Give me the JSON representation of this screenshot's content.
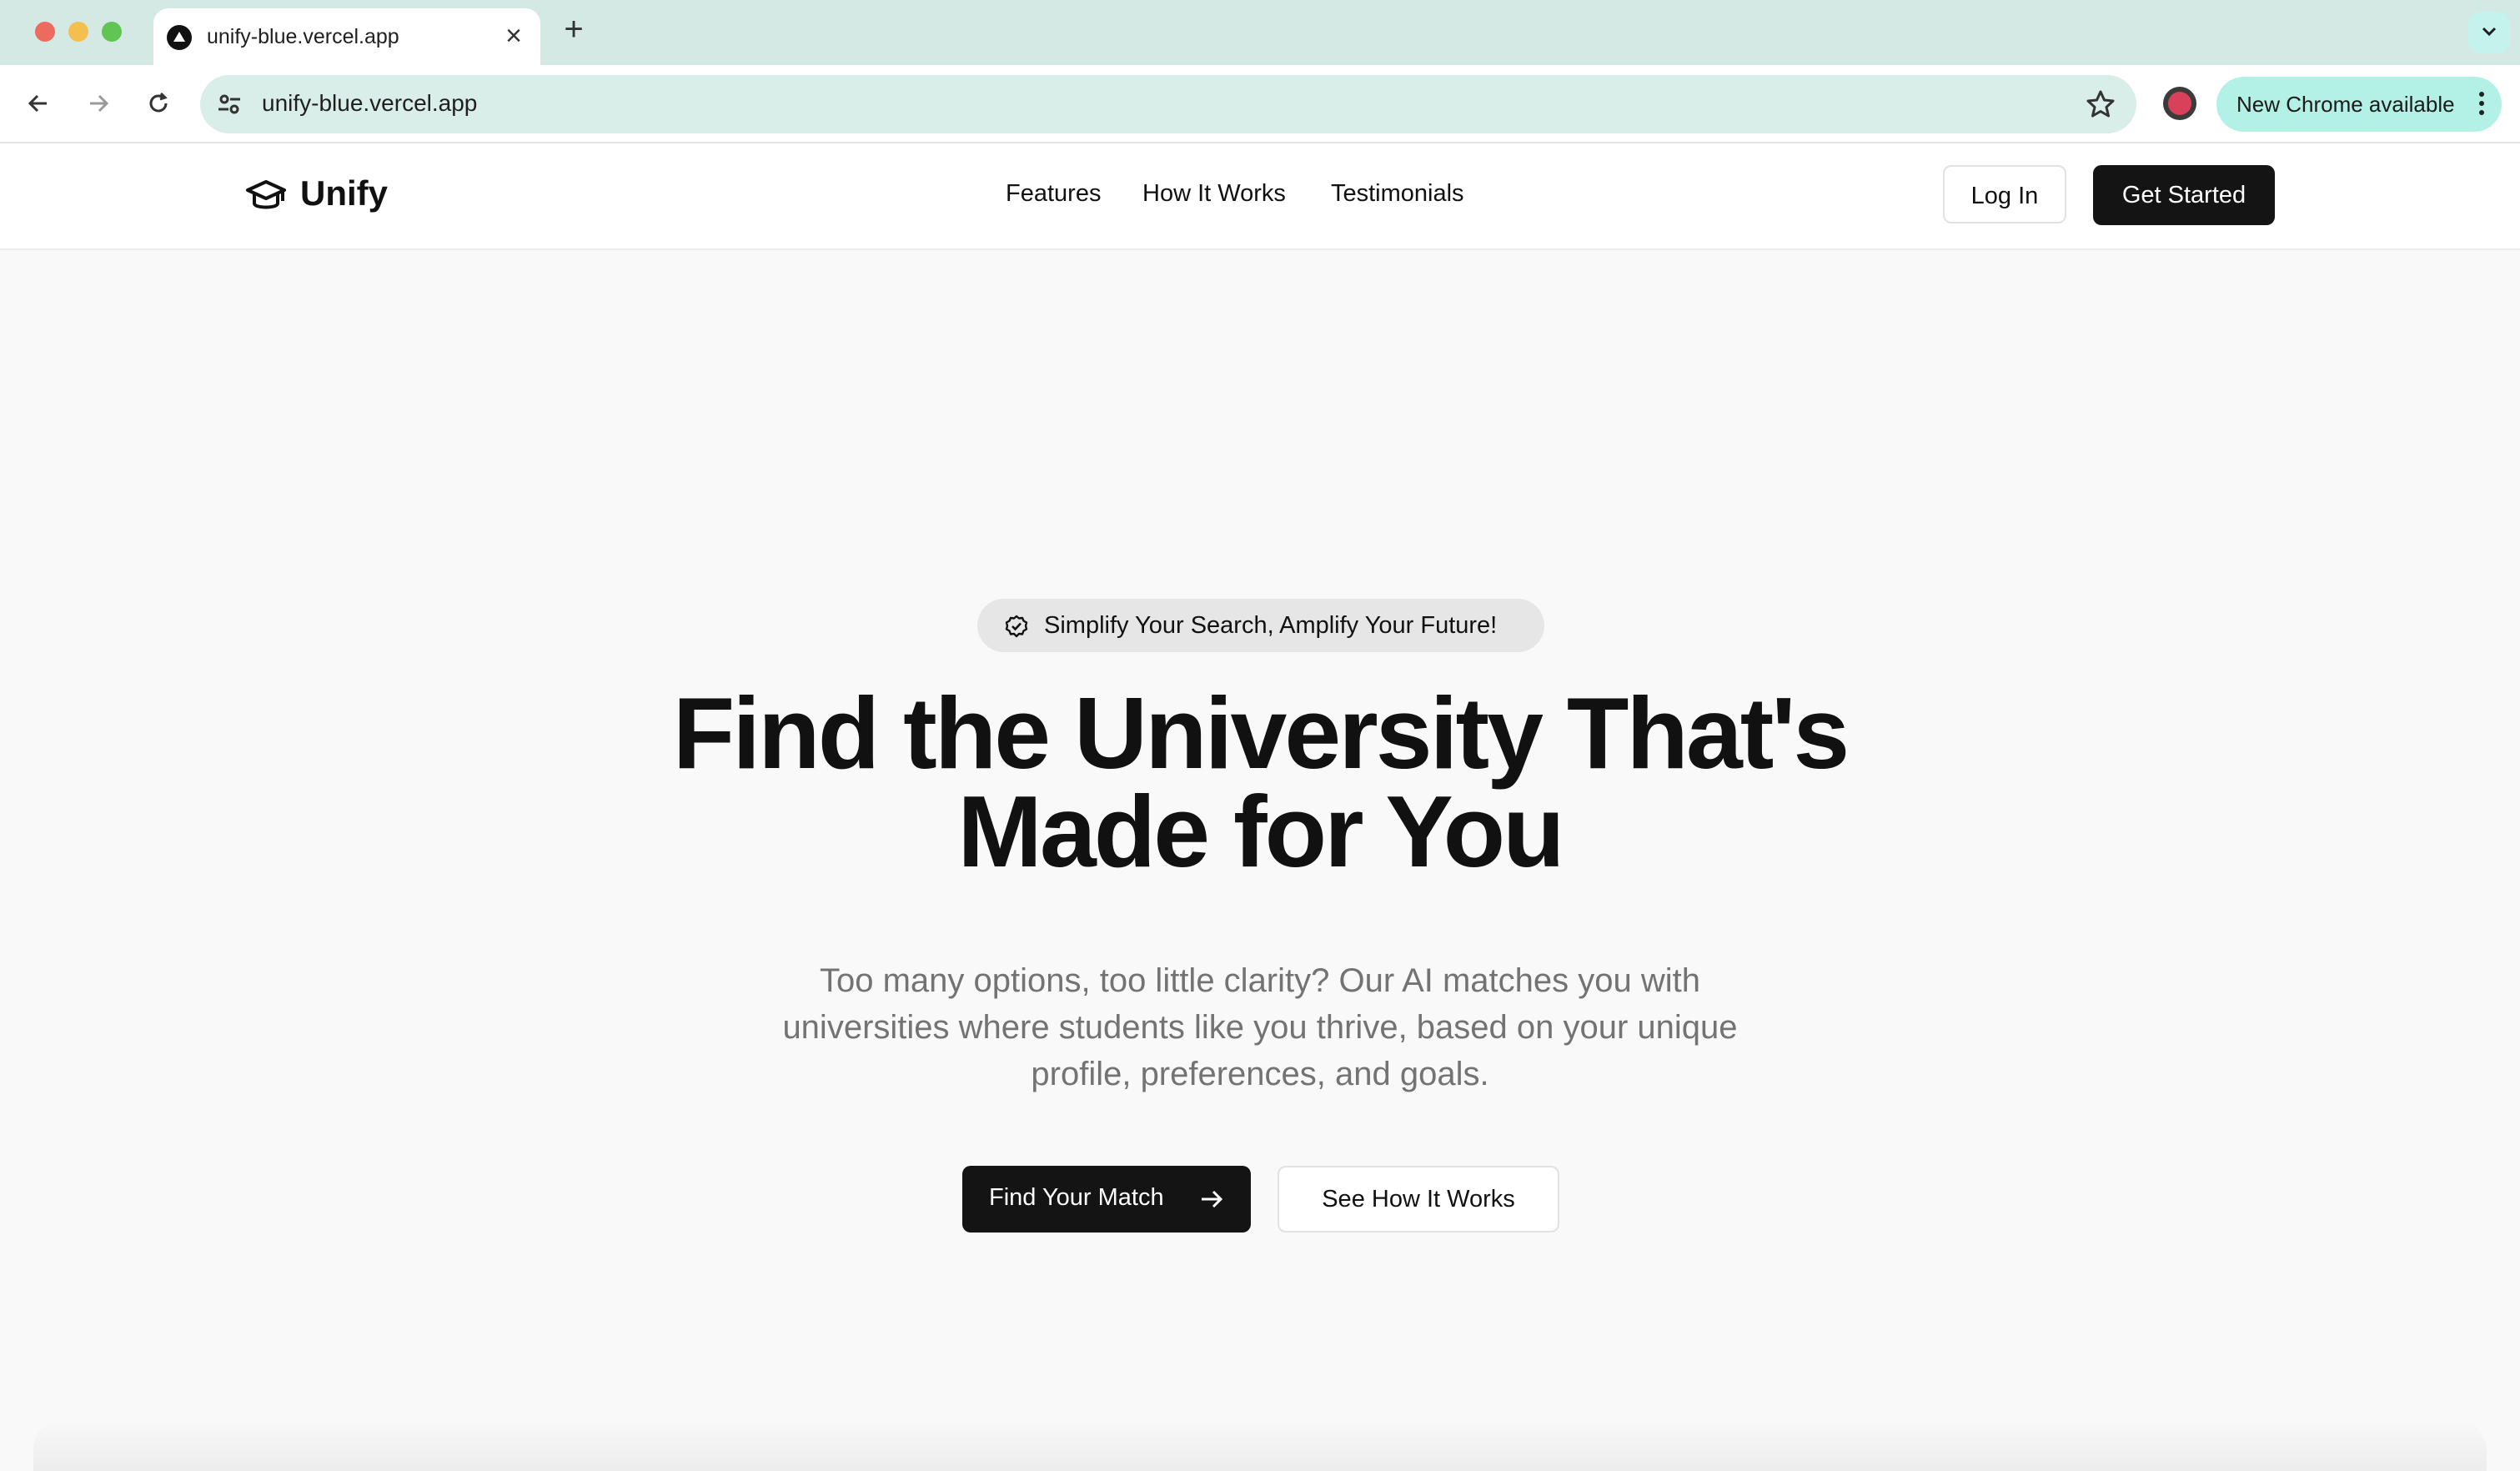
{
  "browser": {
    "tab": {
      "title": "unify-blue.vercel.app",
      "favicon": "vercel-triangle-icon"
    },
    "url": "unify-blue.vercel.app",
    "update_label": "New Chrome available"
  },
  "site": {
    "brand": "Unify",
    "nav": [
      "Features",
      "How It Works",
      "Testimonials"
    ],
    "login_label": "Log In",
    "cta_label": "Get Started"
  },
  "hero": {
    "badge": "Simplify Your Search, Amplify Your Future!",
    "title_line1": "Find the University That's",
    "title_line2": "Made for You",
    "subtitle": "Too many options, too little clarity? Our AI matches you with universities where students like you thrive, based on your unique profile, preferences, and goals.",
    "primary_button": "Find Your Match",
    "secondary_button": "See How It Works"
  },
  "colors": {
    "accent_dark": "#141414",
    "tabstrip": "#d5e9e4",
    "page_bg": "#f9f9f9"
  }
}
